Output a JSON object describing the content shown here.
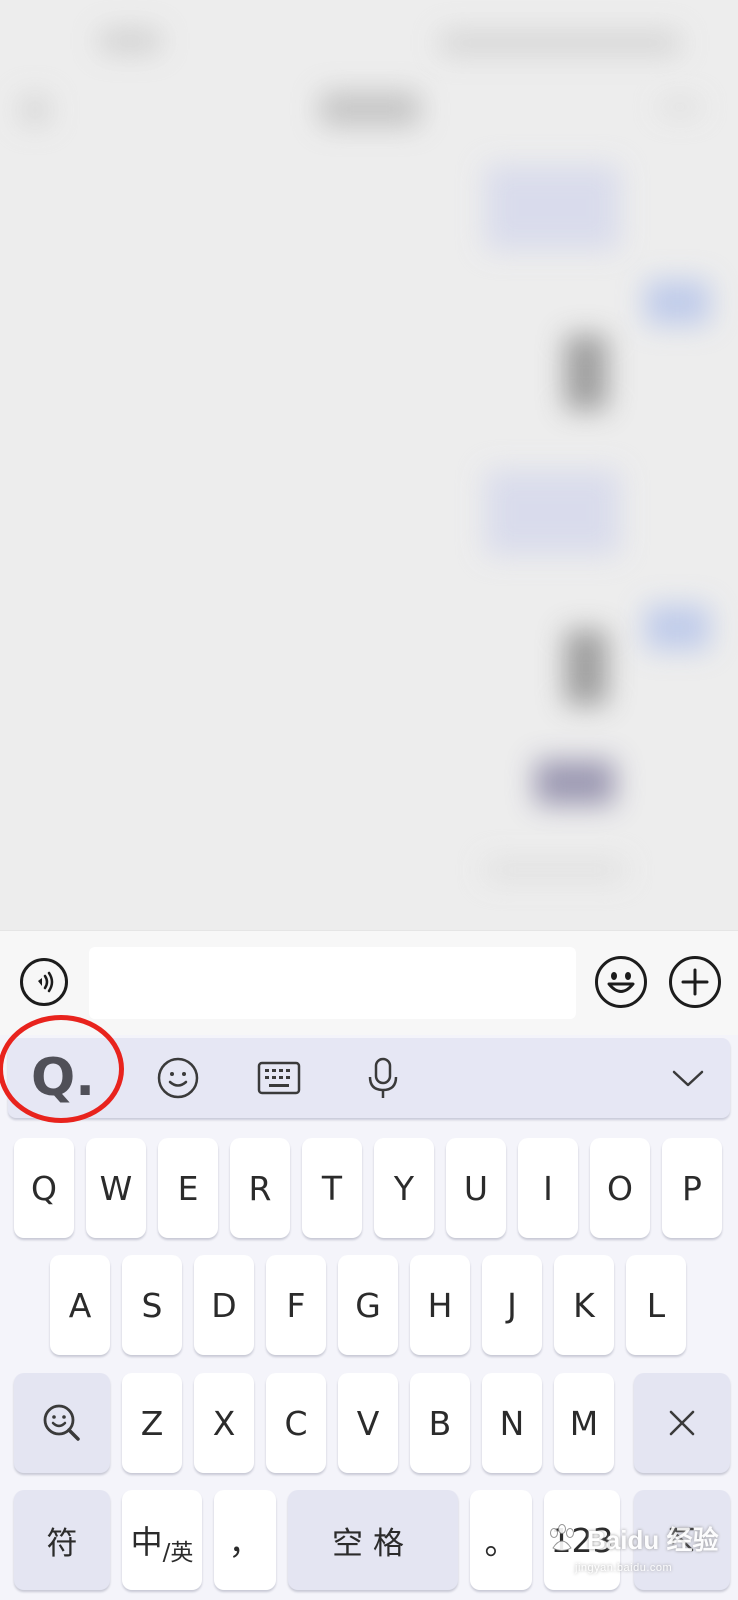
{
  "input_bar": {
    "message_value": "",
    "voice_icon": "voice-wave-icon",
    "emoji_icon": "smiley-icon",
    "plus_icon": "plus-circle-icon"
  },
  "keyboard": {
    "toolbar": {
      "logo_label": "Q.",
      "icons": [
        "emoji-icon",
        "keyboard-icon",
        "microphone-icon",
        "chevron-down-icon"
      ]
    },
    "row1": [
      "Q",
      "W",
      "E",
      "R",
      "T",
      "Y",
      "U",
      "I",
      "O",
      "P"
    ],
    "row2": [
      "A",
      "S",
      "D",
      "F",
      "G",
      "H",
      "J",
      "K",
      "L"
    ],
    "row3": [
      "Z",
      "X",
      "C",
      "V",
      "B",
      "N",
      "M"
    ],
    "row4": {
      "symbols": "符",
      "lang_main": "中",
      "lang_sub": "/英",
      "comma": "，",
      "space": "空格",
      "period": "。",
      "numbers": "123"
    }
  },
  "watermark": {
    "brand": "Baidu 经验",
    "url": "jingyan.baidu.com"
  },
  "colors": {
    "highlight_ring": "#e8231d",
    "keyboard_bg": "#f4f4fa",
    "function_key": "#e4e5f2"
  }
}
